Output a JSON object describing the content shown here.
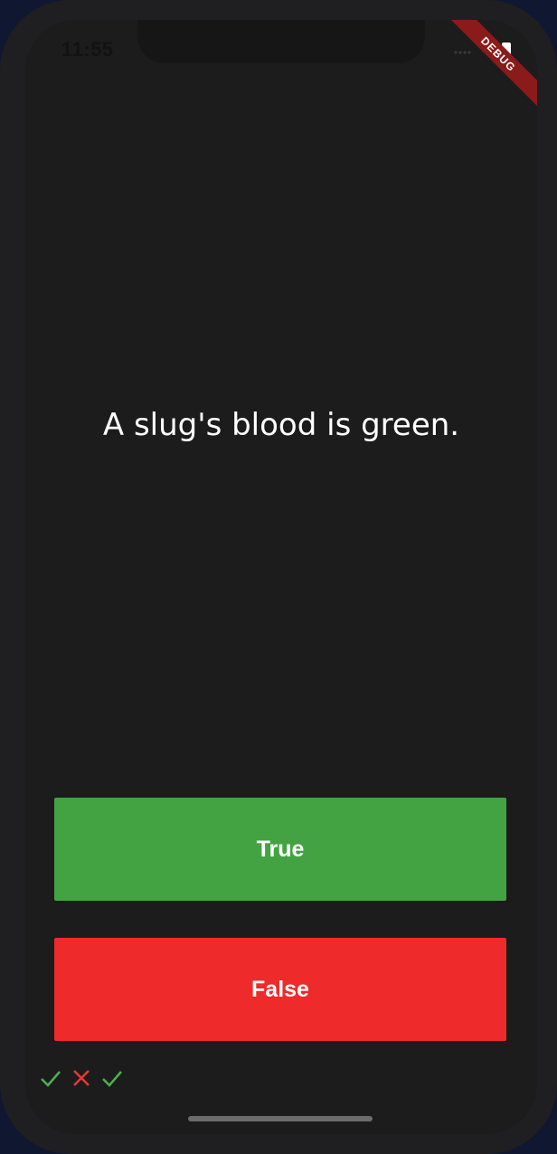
{
  "status_bar": {
    "time": "11:55"
  },
  "debug_banner": {
    "label": "DEBUG"
  },
  "quiz": {
    "question": "A slug's blood is green.",
    "true_label": "True",
    "false_label": "False"
  },
  "score": [
    {
      "icon": "check-icon",
      "color": "#4caf50"
    },
    {
      "icon": "close-icon",
      "color": "#e53935"
    },
    {
      "icon": "check-icon",
      "color": "#4caf50"
    }
  ],
  "colors": {
    "true_button": "#43a343",
    "false_button": "#ef2a2a",
    "background": "#1c1c1c"
  }
}
